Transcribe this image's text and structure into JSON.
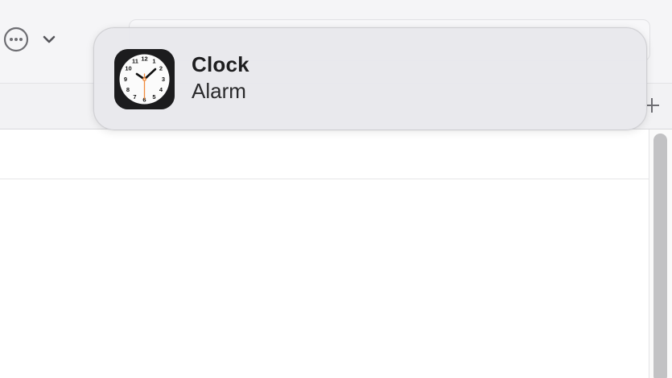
{
  "notification": {
    "app_name": "Clock",
    "message": "Alarm",
    "app_icon": "clock-icon"
  },
  "toolbar": {
    "more_icon": "ellipsis-circle-icon",
    "chevron_icon": "chevron-down-icon",
    "new_tab_icon": "plus-icon"
  },
  "colors": {
    "toolbar_bg": "#f5f5f7",
    "notification_bg": "#e8e8ec",
    "icon_bg": "#1c1c1e",
    "second_hand": "#f08a3c",
    "scroll_thumb": "#c2c2c4"
  }
}
